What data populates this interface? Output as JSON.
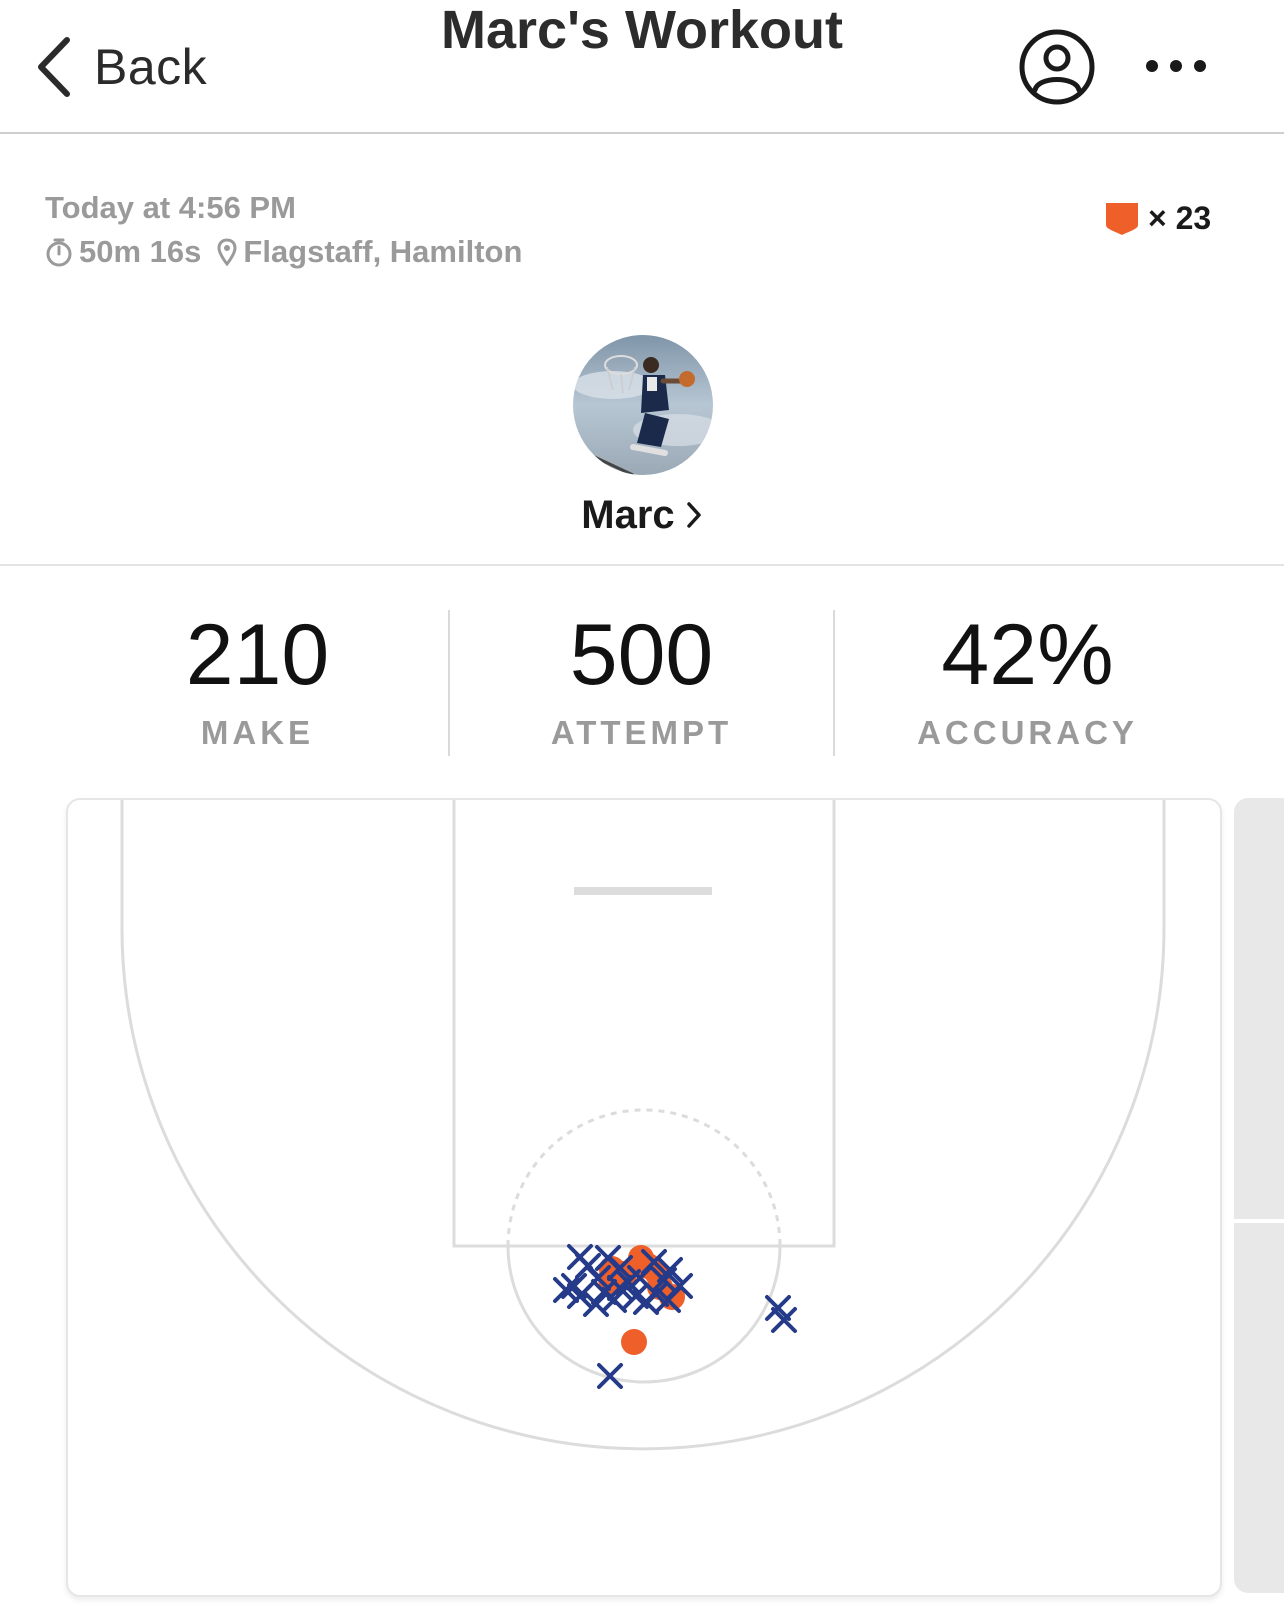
{
  "header": {
    "back_label": "Back",
    "title": "Marc's Workout"
  },
  "meta": {
    "date": "Today at 4:56 PM",
    "duration": "50m 16s",
    "location": "Flagstaff, Hamilton",
    "badge_count": "× 23",
    "badge_color": "#ee5f2a"
  },
  "athlete": {
    "name": "Marc"
  },
  "stats": [
    {
      "value": "210",
      "label": "MAKE"
    },
    {
      "value": "500",
      "label": "ATTEMPT"
    },
    {
      "value": "42%",
      "label": "ACCURACY"
    }
  ],
  "colors": {
    "make": "#ee5f2a",
    "miss": "#253b8a",
    "court_line": "#dcdcdc"
  }
}
